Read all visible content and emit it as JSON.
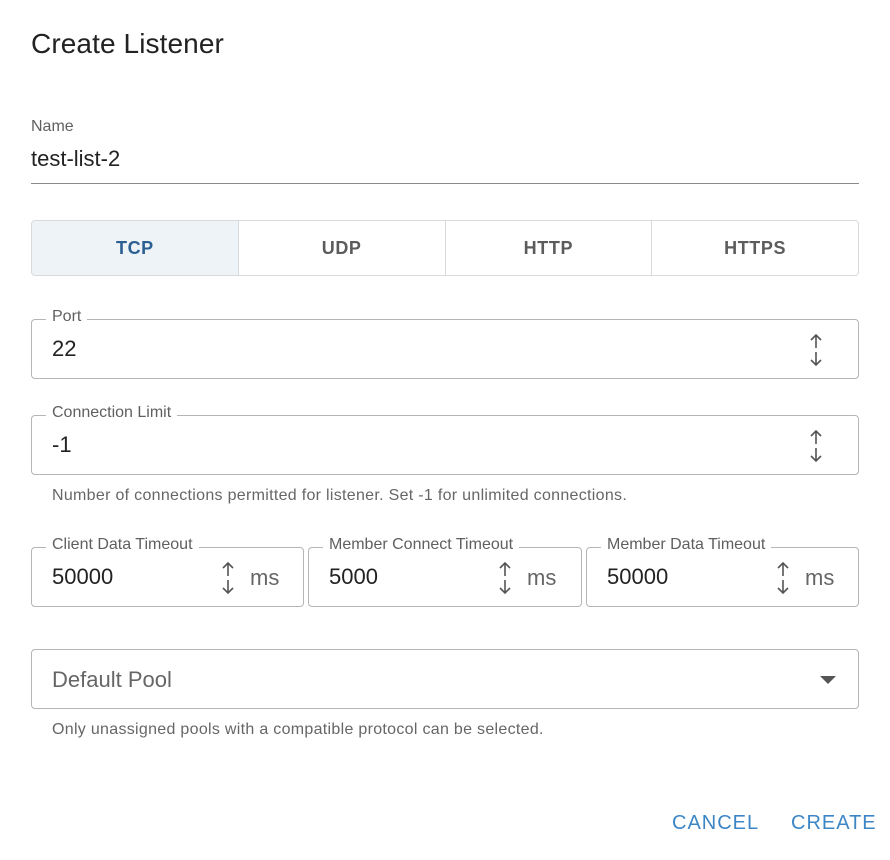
{
  "dialog": {
    "title": "Create Listener"
  },
  "name_field": {
    "label": "Name",
    "value": "test-list-2"
  },
  "protocols": [
    {
      "label": "TCP",
      "active": true
    },
    {
      "label": "UDP",
      "active": false
    },
    {
      "label": "HTTP",
      "active": false
    },
    {
      "label": "HTTPS",
      "active": false
    }
  ],
  "port": {
    "label": "Port",
    "value": "22"
  },
  "connection_limit": {
    "label": "Connection Limit",
    "value": "-1",
    "helper": "Number of connections permitted for listener. Set -1 for unlimited connections."
  },
  "timeouts": {
    "client_data": {
      "label": "Client Data Timeout",
      "value": "50000",
      "unit": "ms"
    },
    "member_connect": {
      "label": "Member Connect Timeout",
      "value": "5000",
      "unit": "ms"
    },
    "member_data": {
      "label": "Member Data Timeout",
      "value": "50000",
      "unit": "ms"
    }
  },
  "default_pool": {
    "placeholder": "Default Pool",
    "helper": "Only unassigned pools with a compatible protocol can be selected."
  },
  "actions": {
    "cancel": "CANCEL",
    "create": "CREATE"
  },
  "colors": {
    "accent": "#3d86c6",
    "active_tab_bg": "#eef3f8",
    "active_tab_text": "#2c5f91"
  },
  "icons": {
    "stepper": "up-down-arrows-icon",
    "dropdown": "caret-down-icon"
  }
}
